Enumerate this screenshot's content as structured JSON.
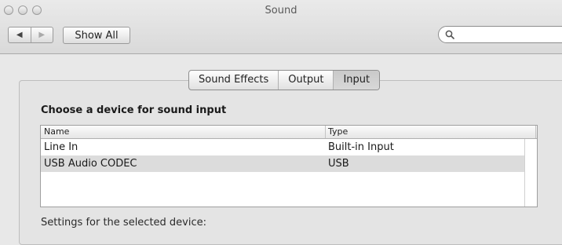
{
  "window": {
    "title": "Sound"
  },
  "toolbar": {
    "back_glyph": "◀",
    "forward_glyph": "▶",
    "show_all_label": "Show All",
    "search_placeholder": ""
  },
  "tabs": [
    {
      "label": "Sound Effects",
      "active": false
    },
    {
      "label": "Output",
      "active": false
    },
    {
      "label": "Input",
      "active": true
    }
  ],
  "input": {
    "heading": "Choose a device for sound input",
    "columns": [
      "Name",
      "Type"
    ],
    "rows": [
      {
        "name": "Line In",
        "type": "Built-in Input",
        "selected": false
      },
      {
        "name": "USB Audio CODEC",
        "type": "USB",
        "selected": true
      }
    ],
    "settings_label": "Settings for the selected device:"
  }
}
